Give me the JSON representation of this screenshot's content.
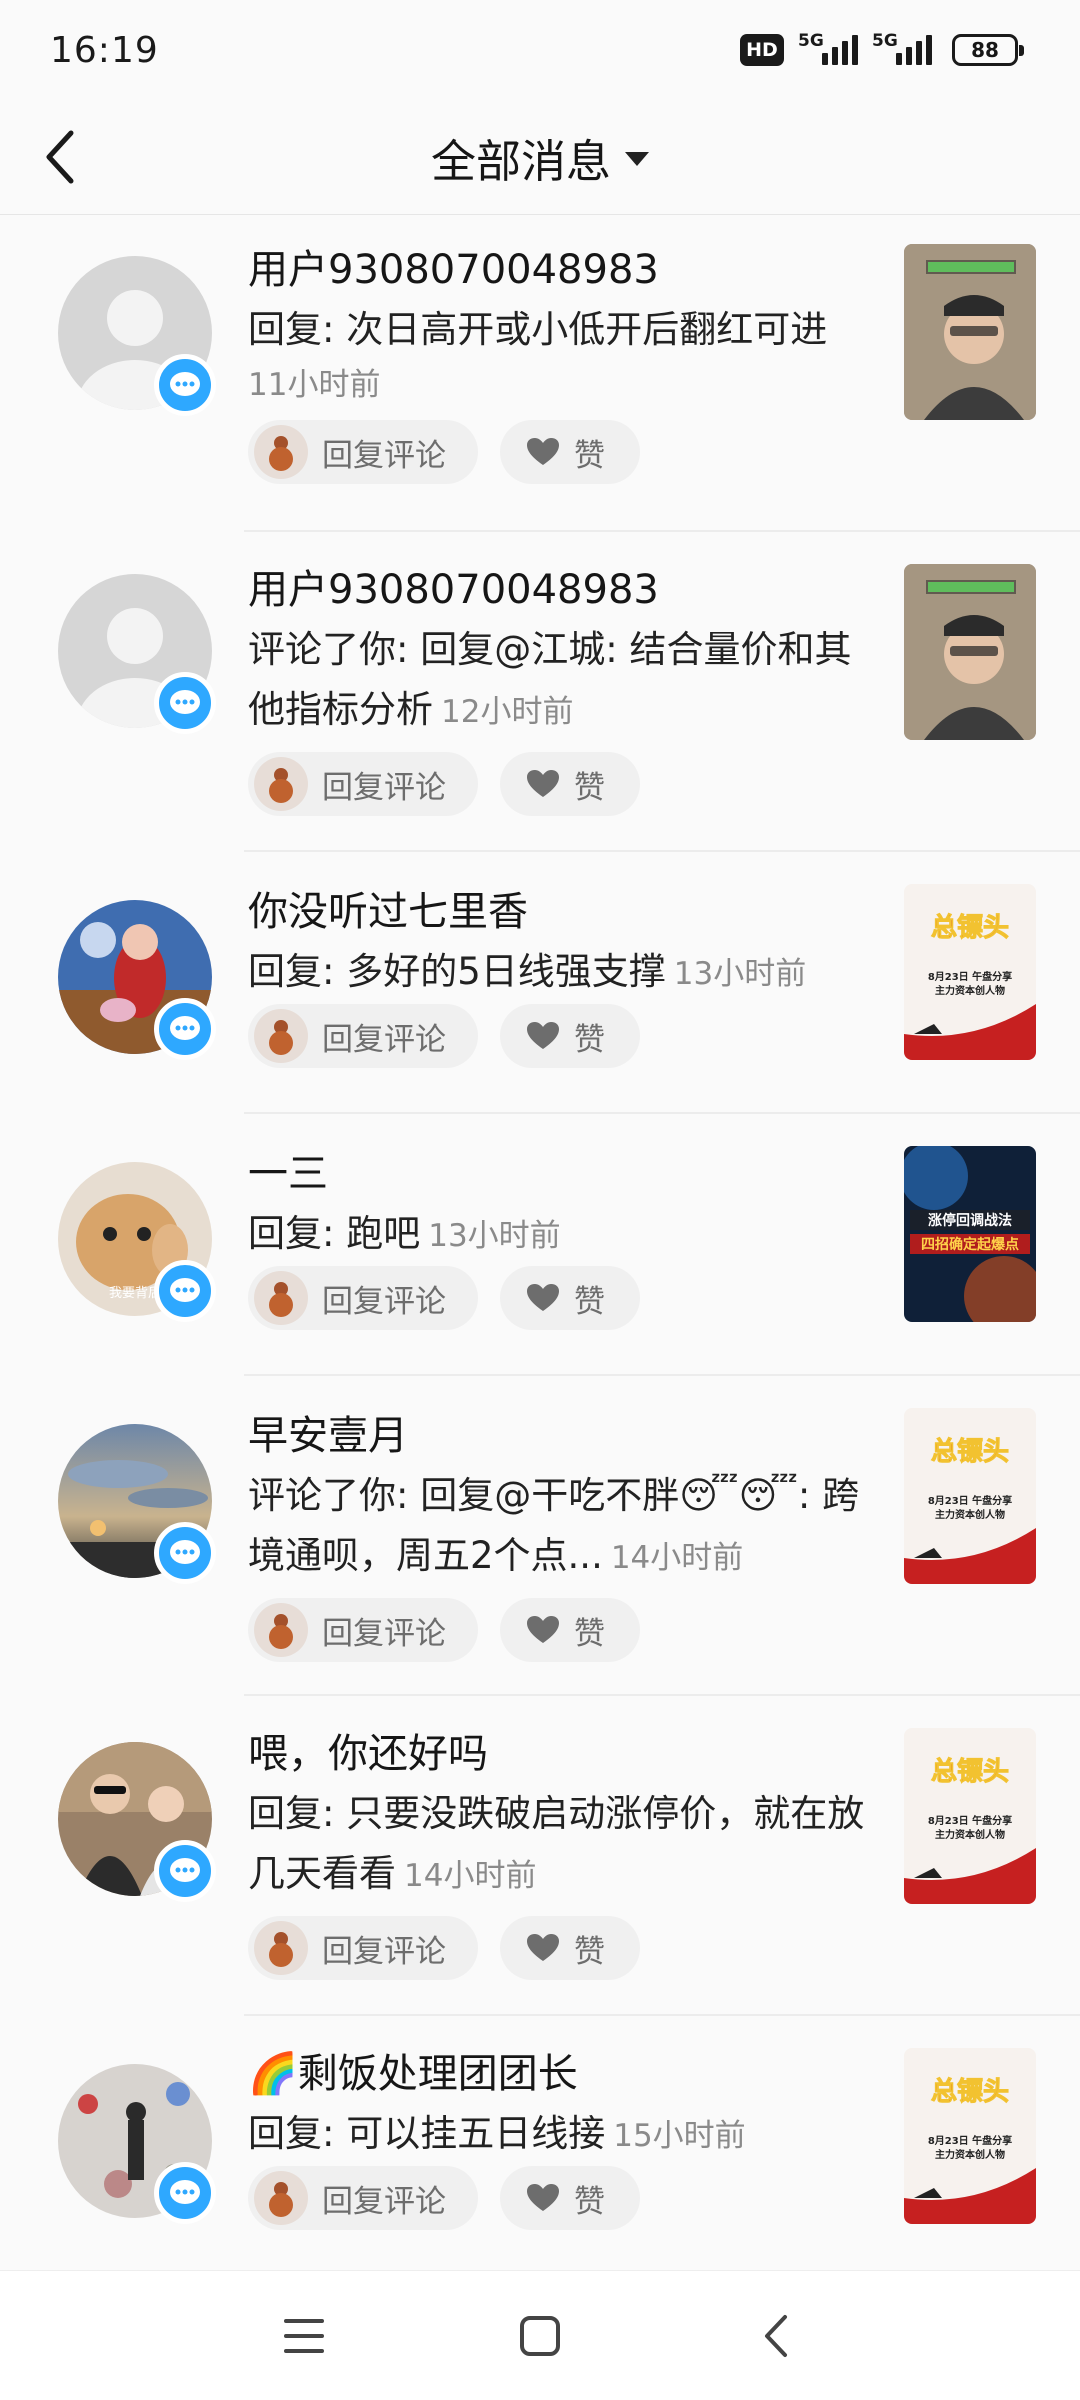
{
  "status": {
    "time": "16:19",
    "hd": "HD",
    "net1": "5G",
    "net2": "5G",
    "battery": "88"
  },
  "header": {
    "title": "全部消息"
  },
  "actions": {
    "reply": "回复评论",
    "like": "赞"
  },
  "items": [
    {
      "name": "用户9308070048983",
      "text": "回复: 次日高开或小低开后翻红可进",
      "time": "11小时前",
      "avatar": "default",
      "thumb": "person"
    },
    {
      "name": "用户9308070048983",
      "text": "评论了你: 回复@江城: 结合量价和其他指标分析",
      "time": "12小时前",
      "avatar": "default",
      "thumb": "person"
    },
    {
      "name": "你没听过七里香",
      "text": "回复: 多好的5日线强支撑",
      "time": "13小时前",
      "avatar": "cartoon",
      "thumb": "poster"
    },
    {
      "name": "一三",
      "text": "回复: 跑吧",
      "time": "13小时前",
      "avatar": "cat",
      "avatar_text": "我要背后",
      "thumb": "blue",
      "thumb_text1": "涨停回调战法",
      "thumb_text2": "四招确定起爆点"
    },
    {
      "name": "早安壹月",
      "text": "评论了你: 回复@干吃不胖😴😴: 跨境通呗，周五2个点...",
      "time": "14小时前",
      "avatar": "sky",
      "thumb": "poster"
    },
    {
      "name": "喂，你还好吗",
      "text": "回复: 只要没跌破启动涨停价，就在放几天看看",
      "time": "14小时前",
      "avatar": "couple",
      "thumb": "poster"
    },
    {
      "name": "🌈剩饭处理团团长",
      "text": "回复: 可以挂五日线接",
      "time": "15小时前",
      "avatar": "crowd",
      "thumb": "poster"
    }
  ],
  "poster": {
    "title": "总镖头",
    "line1": "8月23日  午盘分享",
    "line2": "主力资本创人物"
  },
  "colors": {
    "accent": "#2ea8ff",
    "pill_bg": "#f0f0f0",
    "time": "#8a8a8a"
  }
}
